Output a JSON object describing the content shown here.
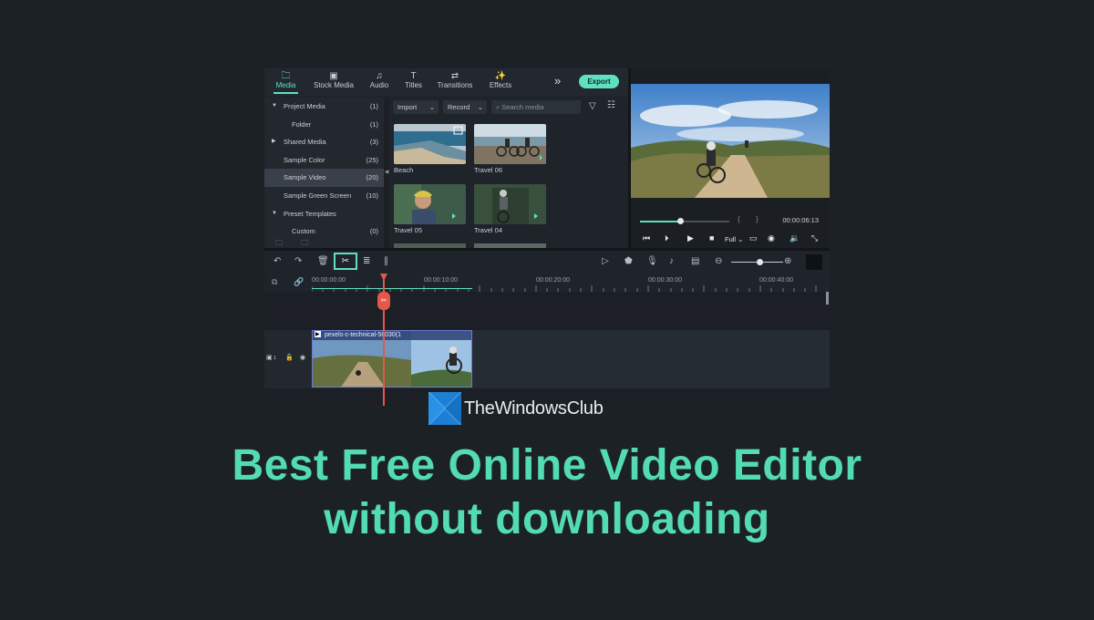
{
  "topbar": {
    "tabs": [
      {
        "label": "Media",
        "icon": "folder-icon",
        "active": true
      },
      {
        "label": "Stock Media",
        "icon": "stock-media-icon",
        "active": false
      },
      {
        "label": "Audio",
        "icon": "music-note-icon",
        "active": false
      },
      {
        "label": "Titles",
        "icon": "text-icon",
        "active": false
      },
      {
        "label": "Transitions",
        "icon": "transitions-icon",
        "active": false
      },
      {
        "label": "Effects",
        "icon": "effects-icon",
        "active": false
      }
    ],
    "export_label": "Export"
  },
  "sidebar": {
    "items": [
      {
        "label": "Project Media",
        "count": "(1)",
        "arrow": "▼"
      },
      {
        "label": "Folder",
        "count": "(1)"
      },
      {
        "label": "Shared Media",
        "count": "(3)",
        "arrow": "▶"
      },
      {
        "label": "Sample Color",
        "count": "(25)"
      },
      {
        "label": "Sample Video",
        "count": "(20)",
        "selected": true
      },
      {
        "label": "Sample Green Screen",
        "count": "(10)"
      },
      {
        "label": "Preset Templates",
        "count": "",
        "arrow": "▼"
      },
      {
        "label": "Custom",
        "count": "(0)"
      }
    ]
  },
  "browser": {
    "import_label": "Import",
    "record_label": "Record",
    "search_placeholder": "Search media",
    "thumbnails": [
      "Beach",
      "Travel 06",
      "Travel 05",
      "Travel 04"
    ]
  },
  "preview": {
    "timecode": "00:00:06:13",
    "quality": "Full",
    "progress": 0.45
  },
  "timeline": {
    "ruler_labels": [
      "00:00:00:00",
      "00:00:10:00",
      "00:00:20:00",
      "00:00:30:00",
      "00:00:40:00"
    ],
    "clip_name": "pexels-c-technical-58030(1",
    "track_number": "1"
  },
  "brand": {
    "name": "TheWindowsClub",
    "accent": "#5fe0c0",
    "headline_color": "#53dbb4"
  },
  "headline": {
    "line1": "Best Free Online Video Editor",
    "line2": "without downloading"
  }
}
